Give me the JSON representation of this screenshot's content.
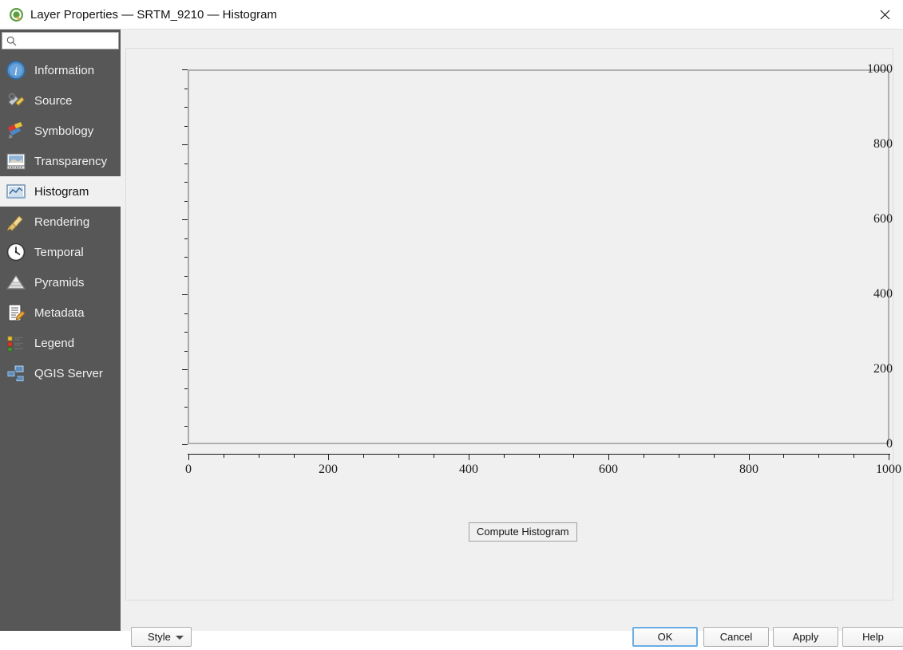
{
  "window": {
    "title": "Layer Properties — SRTM_9210 — Histogram",
    "logo_icon": "qgis-logo-icon",
    "close_icon": "close-icon"
  },
  "sidebar": {
    "search": {
      "placeholder": "",
      "value": "",
      "icon": "search-icon"
    },
    "items": [
      {
        "label": "Information",
        "icon": "information-icon",
        "selected": false
      },
      {
        "label": "Source",
        "icon": "source-icon",
        "selected": false
      },
      {
        "label": "Symbology",
        "icon": "symbology-icon",
        "selected": false
      },
      {
        "label": "Transparency",
        "icon": "transparency-icon",
        "selected": false
      },
      {
        "label": "Histogram",
        "icon": "histogram-icon",
        "selected": true
      },
      {
        "label": "Rendering",
        "icon": "rendering-icon",
        "selected": false
      },
      {
        "label": "Temporal",
        "icon": "temporal-icon",
        "selected": false
      },
      {
        "label": "Pyramids",
        "icon": "pyramids-icon",
        "selected": false
      },
      {
        "label": "Metadata",
        "icon": "metadata-icon",
        "selected": false
      },
      {
        "label": "Legend",
        "icon": "legend-icon",
        "selected": false
      },
      {
        "label": "QGIS Server",
        "icon": "qgis-server-icon",
        "selected": false
      }
    ]
  },
  "main": {
    "compute_button_label": "Compute Histogram"
  },
  "footer": {
    "style_label": "Style",
    "ok_label": "OK",
    "cancel_label": "Cancel",
    "apply_label": "Apply",
    "help_label": "Help"
  },
  "chart_data": {
    "type": "bar",
    "title": "",
    "xlabel": "",
    "ylabel": "",
    "xlim": [
      0,
      1000
    ],
    "ylim": [
      0,
      1000
    ],
    "x_ticks": [
      0,
      200,
      400,
      600,
      800,
      1000
    ],
    "y_ticks": [
      0,
      200,
      400,
      600,
      800,
      1000
    ],
    "x_minor_step": 50,
    "y_minor_step": 50,
    "grid": false,
    "legend": null,
    "series": [],
    "values": [],
    "categories": [],
    "note": "empty plot — histogram not yet computed"
  }
}
